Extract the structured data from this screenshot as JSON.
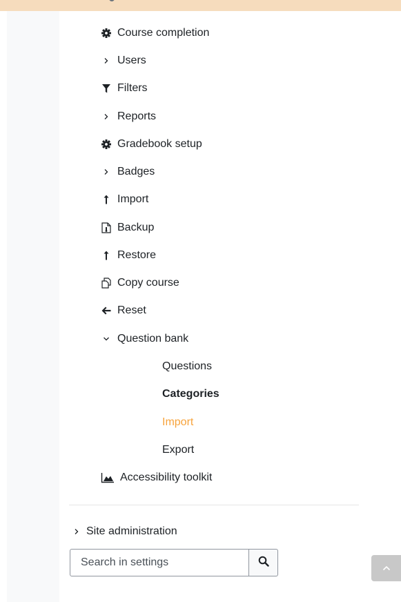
{
  "colors": {
    "top_strip": "#f6dcbd",
    "text": "#1d2125",
    "active": "#f7a33b",
    "panel_bg": "#f8f9fa",
    "back_to_top_bg": "#c8c8c8"
  },
  "nav": {
    "items": [
      {
        "label": "Course completion",
        "icon": "gear-icon"
      },
      {
        "label": "Users",
        "icon": "chevron-right-icon"
      },
      {
        "label": "Filters",
        "icon": "filter-icon"
      },
      {
        "label": "Reports",
        "icon": "chevron-right-icon"
      },
      {
        "label": "Gradebook setup",
        "icon": "gear-icon"
      },
      {
        "label": "Badges",
        "icon": "chevron-right-icon"
      },
      {
        "label": "Import",
        "icon": "upload-arrow-icon"
      },
      {
        "label": "Backup",
        "icon": "backup-file-icon"
      },
      {
        "label": "Restore",
        "icon": "upload-arrow-icon"
      },
      {
        "label": "Copy course",
        "icon": "copy-icon"
      },
      {
        "label": "Reset",
        "icon": "arrow-left-icon"
      },
      {
        "label": "Question bank",
        "icon": "chevron-down-icon",
        "expanded": true
      },
      {
        "label": "Accessibility toolkit",
        "icon": "chart-area-icon"
      }
    ],
    "question_bank": {
      "children": [
        {
          "label": "Questions",
          "state": "normal"
        },
        {
          "label": "Categories",
          "state": "bold"
        },
        {
          "label": "Import",
          "state": "active"
        },
        {
          "label": "Export",
          "state": "normal"
        }
      ]
    }
  },
  "site_admin": {
    "label": "Site administration",
    "icon": "chevron-right-icon"
  },
  "search": {
    "placeholder": "Search in settings",
    "value": "",
    "icon": "search-icon"
  },
  "back_to_top": {
    "icon": "chevron-up-icon"
  }
}
